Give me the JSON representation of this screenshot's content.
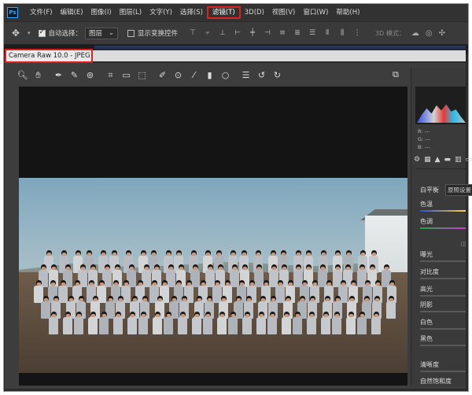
{
  "menubar": {
    "logo": "Ps",
    "items": [
      "文件(F)",
      "编辑(E)",
      "图像(I)",
      "图层(L)",
      "文字(Y)",
      "选择(S)",
      "滤镜(T)",
      "3D(D)",
      "视图(V)",
      "窗口(W)",
      "帮助(H)"
    ],
    "active_index": 6
  },
  "options_bar": {
    "auto_select_label": "自动选择：",
    "auto_select_value": "图层",
    "show_transform_label": "显示变换控件",
    "mode_3d_label": "3D 模式："
  },
  "camera_raw": {
    "title": "Camera Raw 10.0 - JPEG",
    "panel": {
      "rgb": [
        "R:  ---",
        "G:  ---",
        "B:  ---"
      ],
      "white_balance_label": "白平衡",
      "white_balance_value": "原照设置",
      "temperature_label": "色温",
      "tint_label": "色调",
      "exposure_label": "曝光",
      "contrast_label": "对比度",
      "highlights_label": "高光",
      "shadows_label": "阴影",
      "whites_label": "白色",
      "blacks_label": "黑色",
      "clarity_label": "清晰度",
      "vibrance_label": "自然饱和度"
    }
  },
  "accent_colors": {
    "highlight_box": "#e02020",
    "ui_dark": "#2b2b2b",
    "panel": "#3a3a3a"
  }
}
